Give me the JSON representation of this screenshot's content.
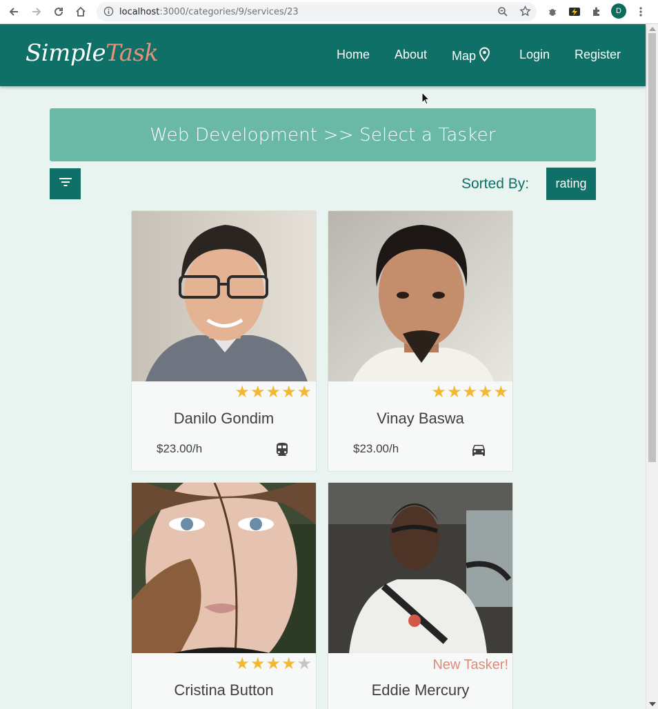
{
  "browser": {
    "url_host": "localhost",
    "url_path": ":3000/categories/9/services/23",
    "profile_initial": "D"
  },
  "navbar": {
    "brand_part1": "Simple",
    "brand_part2": "Task",
    "links": {
      "home": "Home",
      "about": "About",
      "map": "Map",
      "login": "Login",
      "register": "Register"
    }
  },
  "banner": {
    "text": "Web Development >> Select a Tasker"
  },
  "sort": {
    "label": "Sorted By:",
    "value": "rating"
  },
  "colors": {
    "primary": "#0e7066",
    "banner": "#6ab8a6",
    "accent": "#e8907b",
    "star": "#f3b833",
    "background": "#e9f3f0"
  },
  "taskers": [
    {
      "name": "Danilo Gondim",
      "price": "$23.00/h",
      "rating": 5,
      "vehicle": "train-icon",
      "new": ""
    },
    {
      "name": "Vinay Baswa",
      "price": "$23.00/h",
      "rating": 5,
      "vehicle": "car-icon",
      "new": ""
    },
    {
      "name": "Cristina Button",
      "price": "",
      "rating": 4,
      "vehicle": "",
      "new": ""
    },
    {
      "name": "Eddie Mercury",
      "price": "",
      "rating": 0,
      "vehicle": "",
      "new": "New Tasker!"
    }
  ]
}
